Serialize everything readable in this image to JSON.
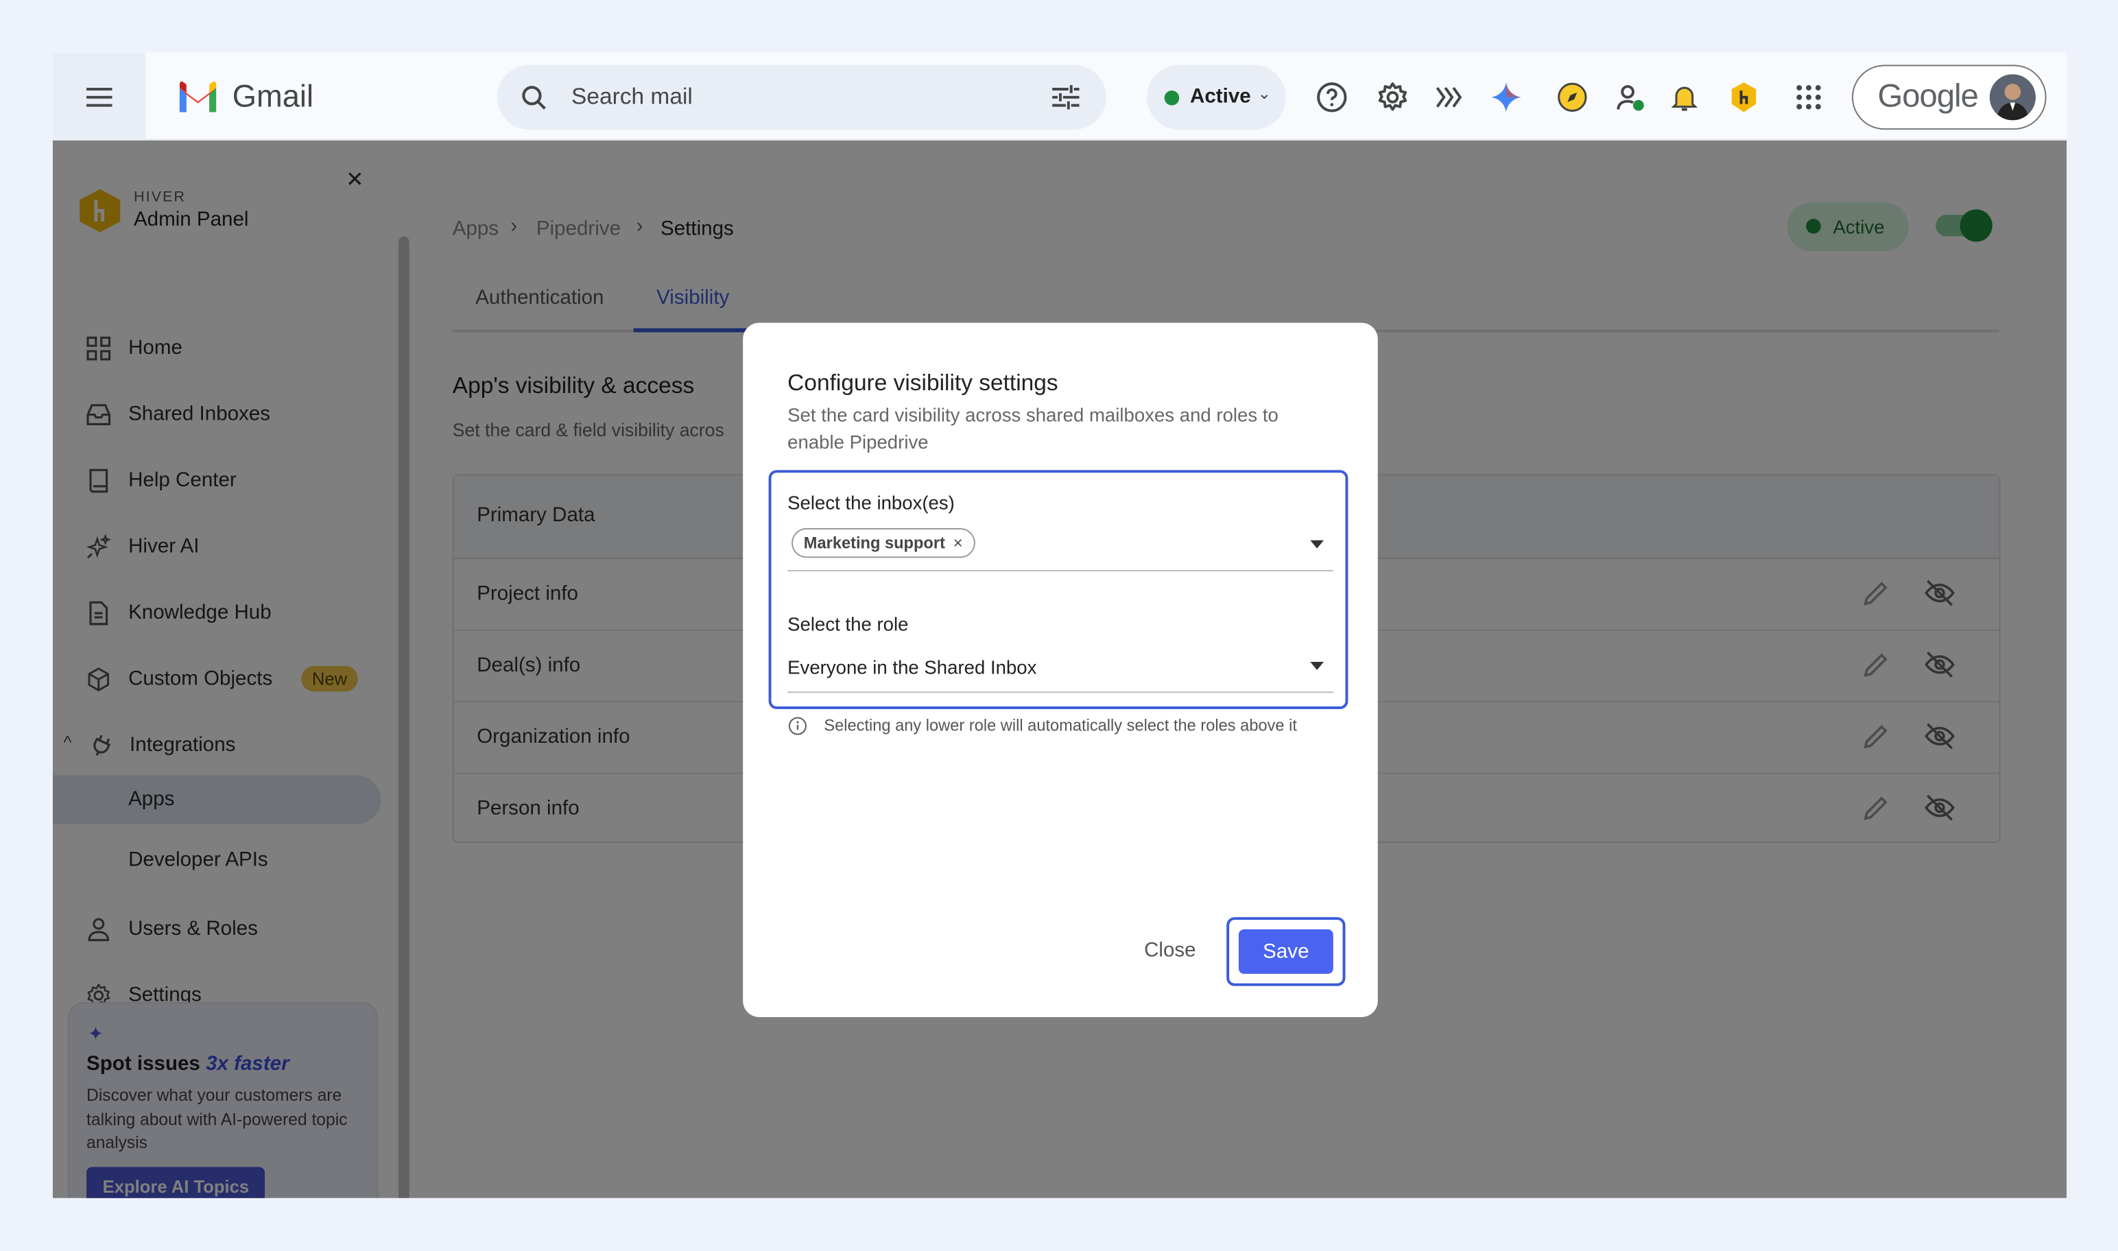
{
  "gmail": {
    "wordmark": "Gmail",
    "search_placeholder": "Search mail",
    "status": "Active",
    "account_brand": "Google"
  },
  "sidebar": {
    "brand_small": "HIVER",
    "brand_title": "Admin Panel",
    "items": [
      {
        "label": "Home",
        "icon": "grid-icon"
      },
      {
        "label": "Shared Inboxes",
        "icon": "inbox-icon"
      },
      {
        "label": "Help Center",
        "icon": "book-icon"
      },
      {
        "label": "Hiver AI",
        "icon": "sparkle-icon"
      },
      {
        "label": "Knowledge Hub",
        "icon": "document-icon"
      },
      {
        "label": "Custom Objects",
        "icon": "cube-icon",
        "badge": "New"
      },
      {
        "label": "Integrations",
        "icon": "plug-icon"
      },
      {
        "label": "Apps"
      },
      {
        "label": "Developer APIs"
      },
      {
        "label": "Users & Roles",
        "icon": "user-icon"
      },
      {
        "label": "Settings",
        "icon": "gear-icon"
      }
    ],
    "selected": "Apps",
    "promo": {
      "heading": "Spot issues",
      "heading_em": "3x faster",
      "desc": "Discover what your customers are talking about with AI-powered topic analysis",
      "button": "Explore AI Topics"
    }
  },
  "main": {
    "breadcrumb": [
      "Apps",
      "Pipedrive",
      "Settings"
    ],
    "status": "Active",
    "toggle_on": true,
    "tabs": [
      "Authentication",
      "Visibility"
    ],
    "active_tab": "Visibility",
    "section_title": "App's visibility & access",
    "section_desc": "Set the card & field visibility acros",
    "table_header": "Primary Data",
    "rows": [
      "Project info",
      "Deal(s) info",
      "Organization info",
      "Person info"
    ]
  },
  "modal": {
    "title": "Configure visibility settings",
    "desc": "Set the card visibility across shared mailboxes and roles to enable Pipedrive",
    "inbox_label": "Select the inbox(es)",
    "inbox_chip": "Marketing support",
    "role_label": "Select the role",
    "role_value": "Everyone in the Shared Inbox",
    "hint": "Selecting any lower role will automatically select the roles above it",
    "close": "Close",
    "save": "Save"
  },
  "colors": {
    "accent": "#3b5bdb",
    "active_green": "#1e8e3e",
    "new_badge": "#f2c94c"
  }
}
